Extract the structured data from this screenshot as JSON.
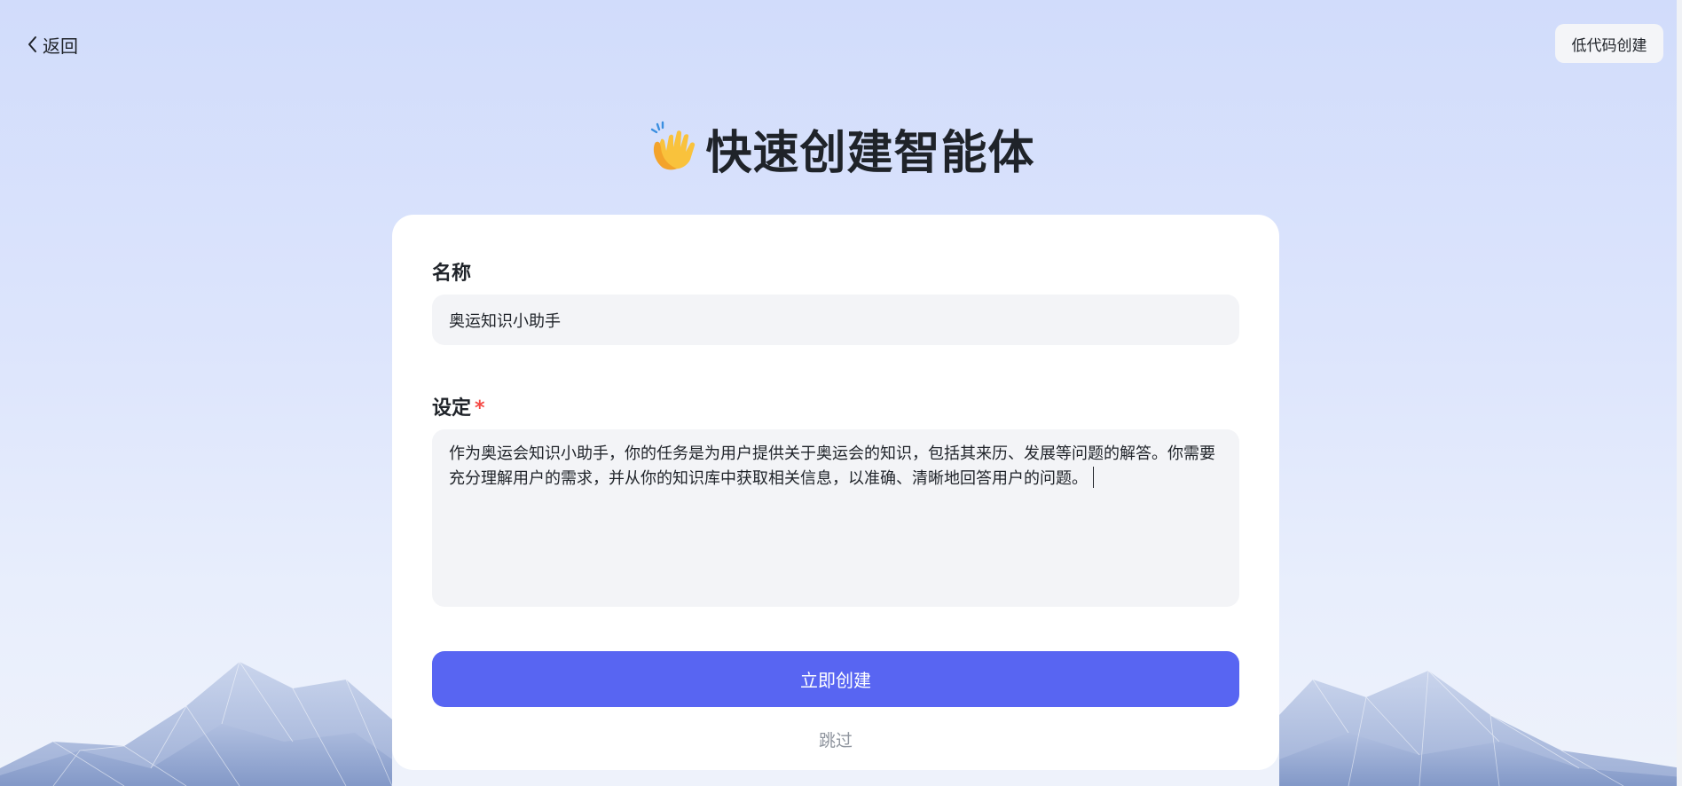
{
  "header": {
    "back_label": "返回",
    "lowcode_label": "低代码创建"
  },
  "title": {
    "emoji": "👏",
    "text": "快速创建智能体"
  },
  "form": {
    "name_label": "名称",
    "name_value": "奥运知识小助手",
    "setting_label": "设定",
    "required_mark": "*",
    "setting_value": "作为奥运会知识小助手，你的任务是为用户提供关于奥运会的知识，包括其来历、发展等问题的解答。你需要充分理解用户的需求，并从你的知识库中获取相关信息，以准确、清晰地回答用户的问题。",
    "create_label": "立即创建",
    "skip_label": "跳过"
  },
  "colors": {
    "primary": "#5865f2",
    "required": "#f54a45",
    "input_bg": "#f3f4f7"
  },
  "icons": {
    "back": "chevron-left-icon",
    "title": "clapping-hands-icon"
  }
}
